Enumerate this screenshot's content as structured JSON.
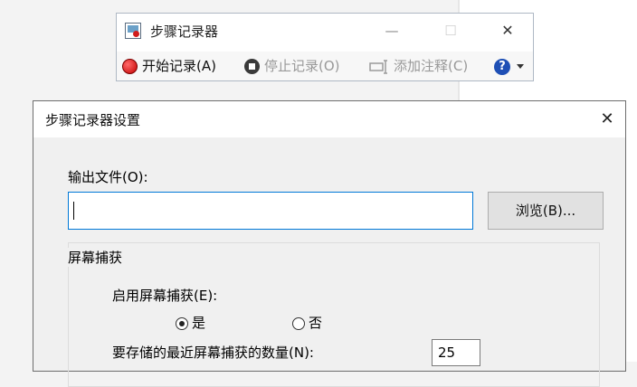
{
  "recorder": {
    "title": "步骤记录器",
    "window_controls": {
      "minimize": "—",
      "maximize": "☐",
      "close": "✕"
    },
    "toolbar": {
      "start_label": "开始记录(A)",
      "stop_label": "停止记录(O)",
      "comment_label": "添加注释(C)",
      "help_glyph": "?"
    }
  },
  "dialog": {
    "title": "步骤记录器设置",
    "close_glyph": "✕",
    "output_label": "输出文件(O):",
    "output_value": "",
    "browse_label": "浏览(B)...",
    "capture_group": {
      "title": "屏幕捕获",
      "enable_label": "启用屏幕捕获(E):",
      "yes_label": "是",
      "no_label": "否",
      "selected": "是",
      "count_label": "要存储的最近屏幕捕获的数量(N):",
      "count_value": "25"
    }
  },
  "colors": {
    "accent": "#0078d7",
    "record": "#d21c1c",
    "help": "#1e4fb5"
  }
}
